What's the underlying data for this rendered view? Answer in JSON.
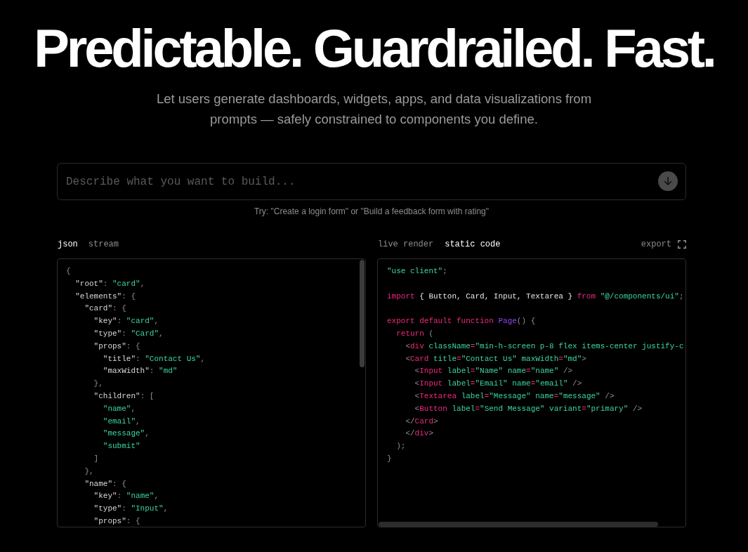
{
  "hero": {
    "title": "Predictable. Guardrailed. Fast.",
    "subtitle": "Let users generate dashboards, widgets, apps, and data visualizations from prompts — safely constrained to components you define."
  },
  "prompt": {
    "placeholder": "Describe what you want to build...",
    "hint": "Try: \"Create a login form\" or \"Build a feedback form with rating\""
  },
  "left_panel": {
    "tabs": [
      {
        "label": "json",
        "selected": true
      },
      {
        "label": "stream",
        "selected": false
      }
    ],
    "lines": [
      [
        {
          "kind": "punct",
          "text": "{"
        }
      ],
      [
        {
          "kind": "key",
          "text": "  \"root\""
        },
        {
          "kind": "punct",
          "text": ": "
        },
        {
          "kind": "string",
          "text": "\"card\""
        },
        {
          "kind": "punct",
          "text": ","
        }
      ],
      [
        {
          "kind": "key",
          "text": "  \"elements\""
        },
        {
          "kind": "punct",
          "text": ": {"
        }
      ],
      [
        {
          "kind": "key",
          "text": "    \"card\""
        },
        {
          "kind": "punct",
          "text": ": {"
        }
      ],
      [
        {
          "kind": "key",
          "text": "      \"key\""
        },
        {
          "kind": "punct",
          "text": ": "
        },
        {
          "kind": "string",
          "text": "\"card\""
        },
        {
          "kind": "punct",
          "text": ","
        }
      ],
      [
        {
          "kind": "key",
          "text": "      \"type\""
        },
        {
          "kind": "punct",
          "text": ": "
        },
        {
          "kind": "string",
          "text": "\"Card\""
        },
        {
          "kind": "punct",
          "text": ","
        }
      ],
      [
        {
          "kind": "key",
          "text": "      \"props\""
        },
        {
          "kind": "punct",
          "text": ": {"
        }
      ],
      [
        {
          "kind": "key",
          "text": "        \"title\""
        },
        {
          "kind": "punct",
          "text": ": "
        },
        {
          "kind": "string",
          "text": "\"Contact Us\""
        },
        {
          "kind": "punct",
          "text": ","
        }
      ],
      [
        {
          "kind": "key",
          "text": "        \"maxWidth\""
        },
        {
          "kind": "punct",
          "text": ": "
        },
        {
          "kind": "string",
          "text": "\"md\""
        }
      ],
      [
        {
          "kind": "punct",
          "text": "      },"
        }
      ],
      [
        {
          "kind": "key",
          "text": "      \"children\""
        },
        {
          "kind": "punct",
          "text": ": ["
        }
      ],
      [
        {
          "kind": "string",
          "text": "        \"name\""
        },
        {
          "kind": "punct",
          "text": ","
        }
      ],
      [
        {
          "kind": "string",
          "text": "        \"email\""
        },
        {
          "kind": "punct",
          "text": ","
        }
      ],
      [
        {
          "kind": "string",
          "text": "        \"message\""
        },
        {
          "kind": "punct",
          "text": ","
        }
      ],
      [
        {
          "kind": "string",
          "text": "        \"submit\""
        }
      ],
      [
        {
          "kind": "punct",
          "text": "      ]"
        }
      ],
      [
        {
          "kind": "punct",
          "text": "    },"
        }
      ],
      [
        {
          "kind": "key",
          "text": "    \"name\""
        },
        {
          "kind": "punct",
          "text": ": {"
        }
      ],
      [
        {
          "kind": "key",
          "text": "      \"key\""
        },
        {
          "kind": "punct",
          "text": ": "
        },
        {
          "kind": "string",
          "text": "\"name\""
        },
        {
          "kind": "punct",
          "text": ","
        }
      ],
      [
        {
          "kind": "key",
          "text": "      \"type\""
        },
        {
          "kind": "punct",
          "text": ": "
        },
        {
          "kind": "string",
          "text": "\"Input\""
        },
        {
          "kind": "punct",
          "text": ","
        }
      ],
      [
        {
          "kind": "key",
          "text": "      \"props\""
        },
        {
          "kind": "punct",
          "text": ": {"
        }
      ]
    ]
  },
  "right_panel": {
    "tabs": [
      {
        "label": "live render",
        "selected": false
      },
      {
        "label": "static code",
        "selected": true
      }
    ],
    "export": "export",
    "blocks": [
      [
        [
          {
            "kind": "string",
            "text": "\"use client\""
          },
          {
            "kind": "punct",
            "text": ";"
          }
        ]
      ],
      [
        [
          {
            "kind": "keyword",
            "text": "import"
          },
          {
            "kind": "ident",
            "text": " { Button, Card, Input, Textarea } "
          },
          {
            "kind": "keyword",
            "text": "from"
          },
          {
            "kind": "string",
            "text": " \"@/components/ui\""
          },
          {
            "kind": "punct",
            "text": ";"
          }
        ]
      ],
      [
        [
          {
            "kind": "keyword",
            "text": "export default function"
          },
          {
            "kind": "func",
            "text": " Page"
          },
          {
            "kind": "punct",
            "text": "() {"
          }
        ],
        [
          {
            "kind": "keyword",
            "text": "  return"
          },
          {
            "kind": "punct",
            "text": " ("
          }
        ],
        [
          {
            "kind": "punct",
            "text": "    <"
          },
          {
            "kind": "tag",
            "text": "div"
          },
          {
            "kind": "attr",
            "text": " className"
          },
          {
            "kind": "op",
            "text": "="
          },
          {
            "kind": "string",
            "text": "\"min-h-screen p-8 flex items-center justify-c"
          }
        ],
        [
          {
            "kind": "punct",
            "text": "    <"
          },
          {
            "kind": "tag",
            "text": "Card"
          },
          {
            "kind": "attr",
            "text": " title"
          },
          {
            "kind": "op",
            "text": "="
          },
          {
            "kind": "string",
            "text": "\"Contact Us\""
          },
          {
            "kind": "attr",
            "text": " maxWidth"
          },
          {
            "kind": "op",
            "text": "="
          },
          {
            "kind": "string",
            "text": "\"md\""
          },
          {
            "kind": "punct",
            "text": ">"
          }
        ],
        [
          {
            "kind": "punct",
            "text": "      <"
          },
          {
            "kind": "tag",
            "text": "Input"
          },
          {
            "kind": "attr",
            "text": " label"
          },
          {
            "kind": "op",
            "text": "="
          },
          {
            "kind": "string",
            "text": "\"Name\""
          },
          {
            "kind": "attr",
            "text": " name"
          },
          {
            "kind": "op",
            "text": "="
          },
          {
            "kind": "string",
            "text": "\"name\""
          },
          {
            "kind": "punct",
            "text": " />"
          }
        ],
        [
          {
            "kind": "punct",
            "text": "      <"
          },
          {
            "kind": "tag",
            "text": "Input"
          },
          {
            "kind": "attr",
            "text": " label"
          },
          {
            "kind": "op",
            "text": "="
          },
          {
            "kind": "string",
            "text": "\"Email\""
          },
          {
            "kind": "attr",
            "text": " name"
          },
          {
            "kind": "op",
            "text": "="
          },
          {
            "kind": "string",
            "text": "\"email\""
          },
          {
            "kind": "punct",
            "text": " />"
          }
        ],
        [
          {
            "kind": "punct",
            "text": "      <"
          },
          {
            "kind": "tag",
            "text": "Textarea"
          },
          {
            "kind": "attr",
            "text": " label"
          },
          {
            "kind": "op",
            "text": "="
          },
          {
            "kind": "string",
            "text": "\"Message\""
          },
          {
            "kind": "attr",
            "text": " name"
          },
          {
            "kind": "op",
            "text": "="
          },
          {
            "kind": "string",
            "text": "\"message\""
          },
          {
            "kind": "punct",
            "text": " />"
          }
        ],
        [
          {
            "kind": "punct",
            "text": "      <"
          },
          {
            "kind": "tag",
            "text": "Button"
          },
          {
            "kind": "attr",
            "text": " label"
          },
          {
            "kind": "op",
            "text": "="
          },
          {
            "kind": "string",
            "text": "\"Send Message\""
          },
          {
            "kind": "attr",
            "text": " variant"
          },
          {
            "kind": "op",
            "text": "="
          },
          {
            "kind": "string",
            "text": "\"primary\""
          },
          {
            "kind": "punct",
            "text": " />"
          }
        ],
        [
          {
            "kind": "punct",
            "text": "    </"
          },
          {
            "kind": "tag",
            "text": "Card"
          },
          {
            "kind": "punct",
            "text": ">"
          }
        ],
        [
          {
            "kind": "punct",
            "text": "    </"
          },
          {
            "kind": "tag",
            "text": "div"
          },
          {
            "kind": "punct",
            "text": ">"
          }
        ],
        [
          {
            "kind": "punct",
            "text": "  );"
          }
        ],
        [
          {
            "kind": "punct",
            "text": "}"
          }
        ]
      ]
    ]
  }
}
